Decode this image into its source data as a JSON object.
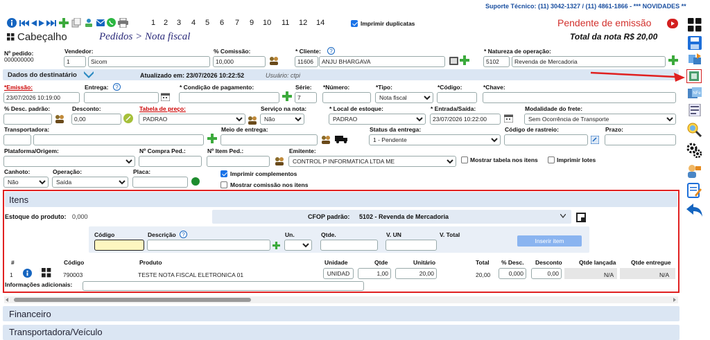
{
  "top": {
    "support_text": "Suporte Técnico: (11) 3042-1327 / (11) 4861-1866 - *** NOVIDADES **",
    "page_numbers": [
      "1",
      "2",
      "3",
      "4",
      "5",
      "6",
      "7",
      "9",
      "10",
      "11",
      "12",
      "14"
    ],
    "print_duplicates_label": "Imprimir duplicatas",
    "status": "Pendente de emissão",
    "header_title": "Cabeçalho",
    "breadcrumb": "Pedidos > Nota fiscal",
    "total_label": "Total da nota R$ 20,00"
  },
  "fields": {
    "order_no_label": "Nº pedido:",
    "order_no": "000000000",
    "seller_label": "Vendedor:",
    "seller_code": "1",
    "seller_name": "Sicom",
    "commission_label": "% Comissão:",
    "commission": "10,000",
    "client_label": "* Cliente:",
    "client_code": "11606",
    "client_name": "ANJU BHARGAVA",
    "nature_label": "* Natureza de operação:",
    "nature_code": "5102",
    "nature_name": "Revenda de Mercadoria"
  },
  "dest": {
    "title": "Dados do destinatário",
    "updated_label": "Atualizado em: 23/07/2026 10:22:52",
    "user_label": "Usuário: ctpi"
  },
  "row2": {
    "emission_label": "*Emissão:",
    "emission": "23/07/2026 10:19:00",
    "delivery_label": "Entrega:",
    "payment_label": "* Condição de pagamento:",
    "series_label": "Série:",
    "series": "7",
    "number_label": "*Número:",
    "type_label": "*Tipo:",
    "type_value": "Nota fiscal",
    "code_label": "*Código:",
    "key_label": "*Chave:"
  },
  "row3": {
    "discount_std_label": "% Desc. padrão:",
    "discount_label": "Desconto:",
    "discount": "0,00",
    "price_table_label": "Tabela de preço:",
    "price_table": "PADRAO",
    "service_label": "Serviço na nota:",
    "service": "Não",
    "stock_place_label": "* Local de estoque:",
    "stock_place": "PADRAO",
    "entry_label": "* Entrada/Saída:",
    "entry": "23/07/2026 10:22:00",
    "freight_label": "Modalidade do frete:",
    "freight": "Sem Ocorrência de Transporte"
  },
  "row4": {
    "carrier_label": "Transportadora:",
    "delivery_mode_label": "Meio de entrega:",
    "delivery_status_label": "Status da entrega:",
    "delivery_status": "1 - Pendente",
    "tracking_label": "Código de rastreio:",
    "deadline_label": "Prazo:"
  },
  "row5": {
    "platform_label": "Plataforma/Origem:",
    "purchase_order_label": "Nº Compra Ped.:",
    "item_order_label": "Nº Item Ped.:",
    "issuer_label": "Emitente:",
    "issuer": "CONTROL P INFORMATICA LTDA ME",
    "show_table_label": "Mostrar tabela nos itens",
    "print_lots_label": "Imprimir lotes"
  },
  "row6": {
    "stub_label": "Canhoto:",
    "stub": "Não",
    "operation_label": "Operação:",
    "operation": "Saída",
    "plate_label": "Placa:",
    "print_complements_label": "Imprimir complementos",
    "show_commission_label": "Mostrar comissão nos itens"
  },
  "items": {
    "title": "Itens",
    "stock_label": "Estoque do produto:",
    "stock_value": "0,000",
    "cfop_label": "CFOP padrão:",
    "cfop_value": "5102 - Revenda de Mercadoria",
    "code_label": "Código",
    "desc_label": "Descrição",
    "unit_label": "Un.",
    "qty_label": "Qtde.",
    "vun_label": "V. UN",
    "vtotal_label": "V. Total",
    "insert_button": "Inserir item",
    "headers": [
      "#",
      "Código",
      "Produto",
      "Unidade",
      "Qtde",
      "Unitário",
      "Total",
      "% Desc.",
      "Desconto",
      "Qtde lançada",
      "Qtde entregue"
    ],
    "row": {
      "num": "1",
      "code": "790003",
      "product": "TESTE NOTA FISCAL ELETRONICA 01",
      "unit": "UNIDAD",
      "qty": "1,00",
      "unit_price": "20,00",
      "total": "20,00",
      "disc_pct": "0,000",
      "discount": "0,00",
      "qty_launched": "N/A",
      "qty_delivered": "N/A"
    },
    "info_label": "Informações adicionais:"
  },
  "footer": {
    "financeiro": "Financeiro",
    "transport": "Transportadora/Veículo"
  },
  "colors": {
    "accent": "#1a73e8",
    "status_red": "#d2302c",
    "section_bg": "#dbe6f3",
    "highlight_red": "#e02020",
    "nav_blue": "#1565c0"
  }
}
